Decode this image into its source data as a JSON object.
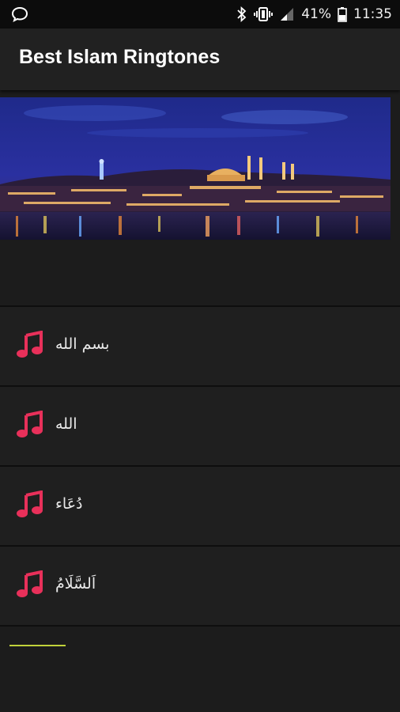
{
  "status_bar": {
    "battery_percent": "41%",
    "time": "11:35",
    "icons": [
      "chat-icon",
      "bluetooth-icon",
      "vibrate-icon",
      "signal-icon",
      "battery-icon"
    ]
  },
  "app_bar": {
    "title": "Best Islam Ringtones"
  },
  "banner": {
    "description_icon": "city-night-skyline-image"
  },
  "ringtones": [
    {
      "label": "بسم الله",
      "icon": "music-note-icon"
    },
    {
      "label": "الله",
      "icon": "music-note-icon"
    },
    {
      "label": "دُعَاء",
      "icon": "music-note-icon"
    },
    {
      "label": "اَلسَّلَامُ",
      "icon": "music-note-icon"
    }
  ],
  "colors": {
    "accent": "#e8305a",
    "background": "#1c1c1c",
    "app_bar": "#212121",
    "progress": "#c0d23a"
  }
}
